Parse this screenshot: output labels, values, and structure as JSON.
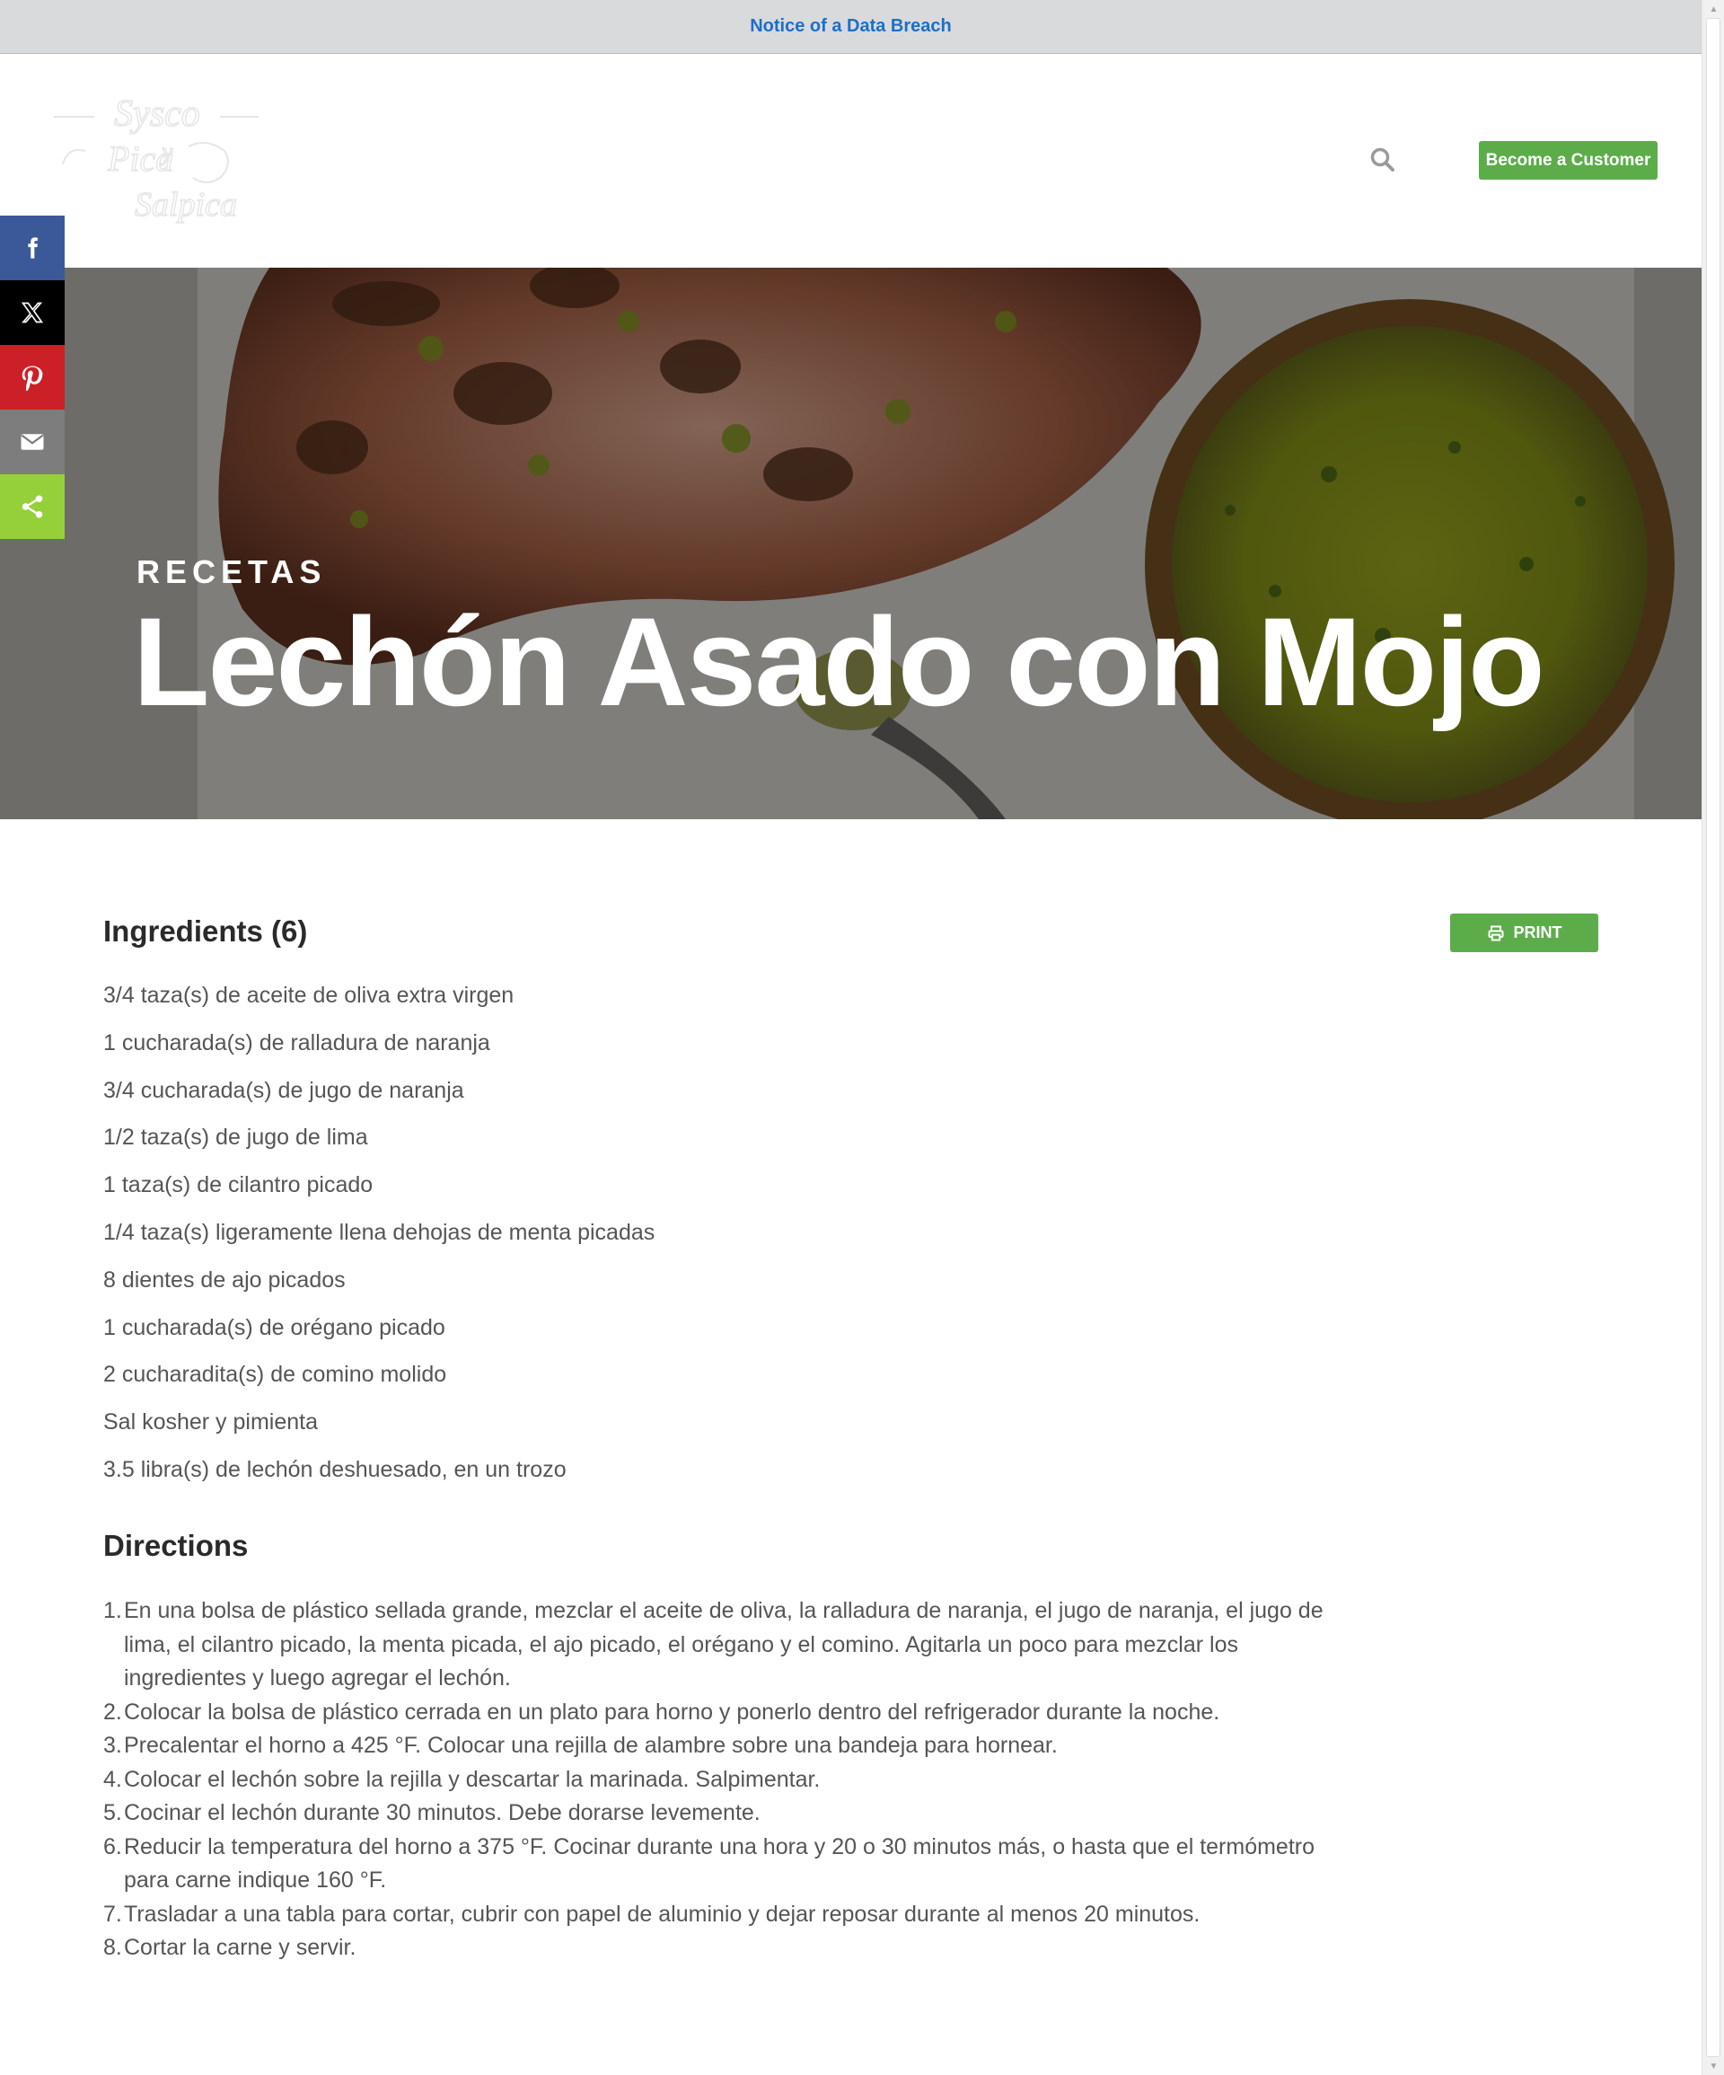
{
  "notice": {
    "text": "Notice of a Data Breach"
  },
  "header": {
    "become_customer_label": "Become a Customer",
    "search_icon": "search-icon",
    "logo_text_top": "Sysco",
    "logo_text_bottom": "Pica y Salpica"
  },
  "hero": {
    "eyebrow": "RECETAS",
    "title": "Lechón Asado con Mojo"
  },
  "social": {
    "items": [
      "facebook-icon",
      "x-icon",
      "pinterest-icon",
      "email-icon",
      "share-icon"
    ],
    "colors": {
      "facebook": "#3b5998",
      "x": "#000000",
      "pinterest": "#cb2027",
      "email": "#7d7d7d",
      "share": "#95d03a"
    }
  },
  "print_label": "PRINT",
  "ingredients": {
    "title": "Ingredients (6)",
    "items": [
      "3/4 taza(s) de aceite de oliva extra virgen",
      "1 cucharada(s) de ralladura de naranja",
      "3/4 cucharada(s) de jugo de naranja",
      "1/2 taza(s) de jugo de lima",
      "1 taza(s) de cilantro picado",
      "1/4 taza(s) ligeramente llena dehojas de menta picadas",
      "8 dientes de ajo picados",
      "1 cucharada(s) de orégano picado",
      "2 cucharadita(s) de comino molido",
      "Sal kosher y pimienta",
      "3.5 libra(s) de lechón deshuesado, en un trozo"
    ]
  },
  "directions": {
    "title": "Directions",
    "items": [
      {
        "num": "1.",
        "text": " En una bolsa de plástico sellada grande, mezclar el aceite de oliva, la ralladura de naranja, el jugo de naranja, el jugo de lima, el cilantro picado, la menta picada, el ajo picado, el orégano y el comino. Agitarla un poco para mezclar los ingredientes y luego agregar el lechón."
      },
      {
        "num": "2.",
        "text": "Colocar la bolsa de plástico cerrada en un plato para horno y ponerlo dentro del refrigerador durante la noche."
      },
      {
        "num": "3.",
        "text": "Precalentar el horno a 425 °F. Colocar una rejilla de alambre sobre una bandeja para hornear."
      },
      {
        "num": "4.",
        "text": "Colocar el lechón sobre la rejilla y descartar la marinada. Salpimentar."
      },
      {
        "num": "5.",
        "text": "Cocinar el lechón durante 30 minutos. Debe dorarse levemente."
      },
      {
        "num": "6.",
        "text": "Reducir la temperatura del horno a 375 °F. Cocinar durante una hora y 20 o 30 minutos más, o hasta que el termómetro para carne indique 160 °F."
      },
      {
        "num": "7.",
        "text": "Trasladar a una tabla para cortar, cubrir con papel de aluminio y dejar reposar durante al menos 20 minutos."
      },
      {
        "num": "8.",
        "text": "Cortar la carne y servir."
      }
    ]
  }
}
